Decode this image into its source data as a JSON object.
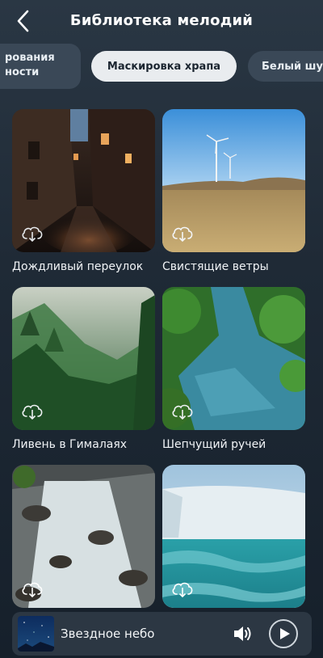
{
  "header": {
    "title": "Библиотека мелодий",
    "back_icon": "chevron-left-icon"
  },
  "tabs": [
    {
      "label": "рования\nности",
      "active": false
    },
    {
      "label": "Маскировка храпа",
      "active": true
    },
    {
      "label": "Белый шум",
      "active": false
    }
  ],
  "cards": [
    {
      "label": "Дождливый переулок",
      "icon": "cloud-download-icon"
    },
    {
      "label": "Свистящие ветры",
      "icon": "cloud-download-icon"
    },
    {
      "label": "Ливень в Гималаях",
      "icon": "cloud-download-icon"
    },
    {
      "label": "Шепчущий ручей",
      "icon": "cloud-download-icon"
    },
    {
      "label": "",
      "icon": "cloud-download-icon"
    },
    {
      "label": "",
      "icon": "cloud-download-icon"
    }
  ],
  "player": {
    "title": "Звездное небо",
    "volume_icon": "volume-icon",
    "play_icon": "play-icon"
  },
  "colors": {
    "background_top": "#2a3744",
    "background_bottom": "#16202b",
    "active_tab": "#e9ecef",
    "inactive_tab": "#3a4857"
  }
}
